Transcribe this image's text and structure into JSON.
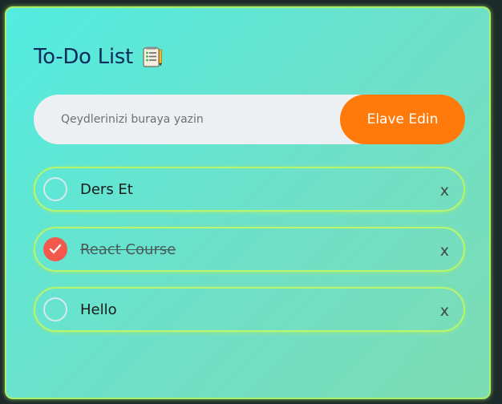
{
  "header": {
    "title": "To-Do List",
    "title_icon": "notepad-icon"
  },
  "input": {
    "placeholder": "Qeydlerinizi buraya yazin",
    "value": ""
  },
  "add_button": {
    "label": "Elave Edin",
    "color": "#ff7a0a"
  },
  "todos": [
    {
      "text": "Ders Et",
      "done": false,
      "delete_label": "x"
    },
    {
      "text": "React Course",
      "done": true,
      "delete_label": "x"
    },
    {
      "text": "Hello",
      "done": false,
      "delete_label": "x"
    }
  ],
  "colors": {
    "background_start": "#52ece0",
    "background_end": "#7ddcb4",
    "border_glow": "#a8f06a",
    "title": "#0d2a5c",
    "checked": "#f2584c"
  }
}
